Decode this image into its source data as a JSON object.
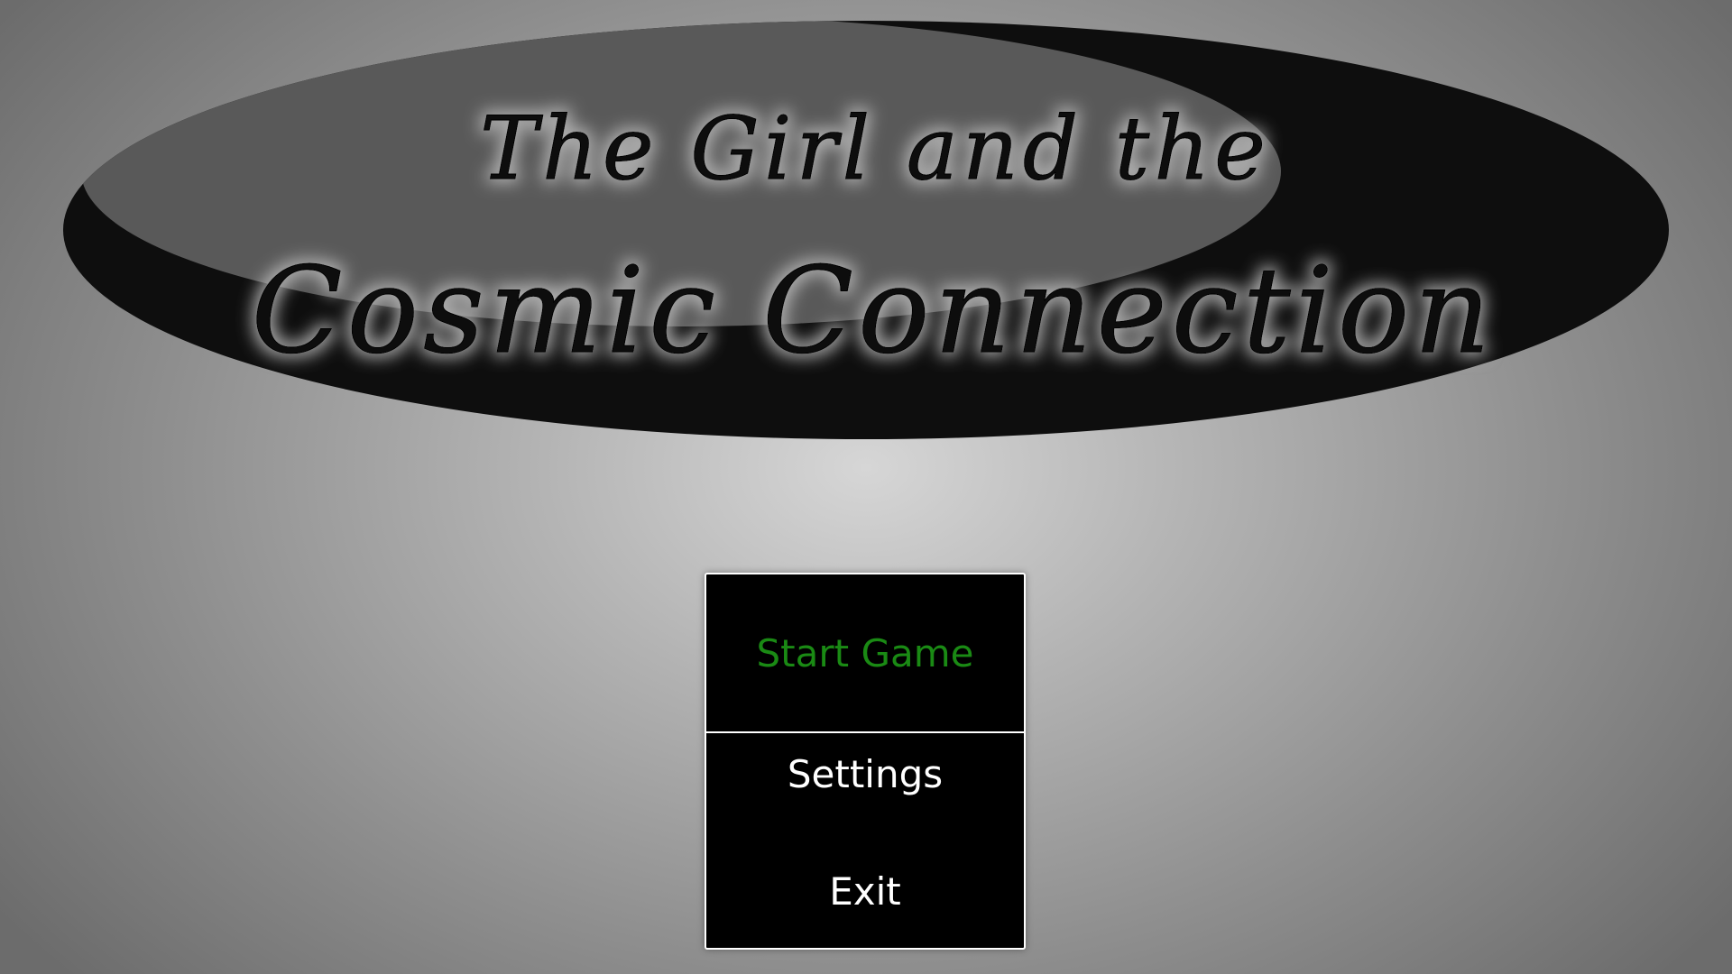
{
  "game": {
    "title_line1": "The Girl and the",
    "title_line2": "Cosmic Connection"
  },
  "menu": {
    "items": [
      {
        "label": "Start Game",
        "selected": true
      },
      {
        "label": "Settings",
        "selected": false
      },
      {
        "label": "Exit",
        "selected": false
      }
    ]
  },
  "colors": {
    "selected_text": "#1a8a14",
    "menu_text": "#ffffff",
    "menu_background": "#000000",
    "logo_dark": "#0e0e0e",
    "logo_light": "#595959"
  }
}
